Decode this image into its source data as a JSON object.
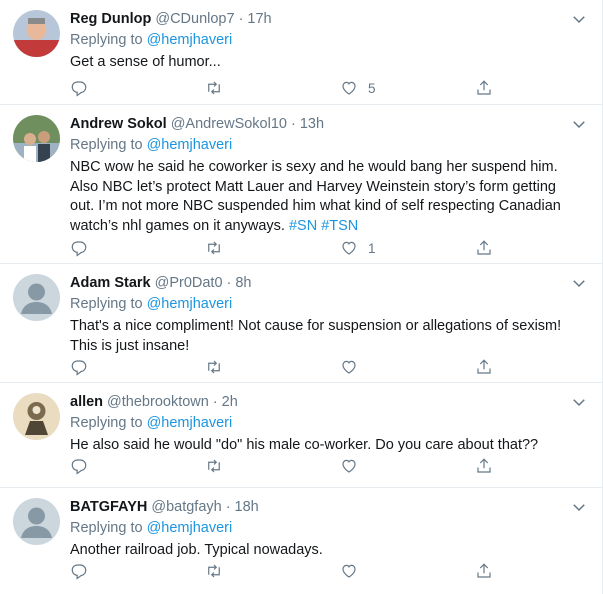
{
  "reply_prefix": "Replying to",
  "colors": {
    "link": "#1b95e0",
    "muted": "#657786",
    "text": "#14171a",
    "border": "#e6ecf0"
  },
  "icons": {
    "reply": "reply-icon",
    "retweet": "retweet-icon",
    "like": "heart-icon",
    "share": "share-icon",
    "menu": "chevron-down-icon"
  },
  "tweets": [
    {
      "name": "Reg Dunlop",
      "handle": "@CDunlop7",
      "time": "17h",
      "replying_to": "@hemjhaveri",
      "text": "Get a sense of humor...",
      "hashtags": "",
      "likes": "5"
    },
    {
      "name": "Andrew Sokol",
      "handle": "@AndrewSokol10",
      "time": "13h",
      "replying_to": "@hemjhaveri",
      "text": "NBC wow he said he coworker is sexy and he would bang her suspend him. Also NBC let’s protect Matt Lauer and Harvey Weinstein story’s form getting out. I’m not more NBC suspended him what kind of self respecting Canadian watch’s nhl games on it anyways. ",
      "hashtags": "#SN #TSN",
      "likes": "1"
    },
    {
      "name": "Adam Stark",
      "handle": "@Pr0Dat0",
      "time": "8h",
      "replying_to": "@hemjhaveri",
      "text": "That's a nice compliment! Not cause for suspension or allegations of sexism! This is just insane!",
      "hashtags": "",
      "likes": ""
    },
    {
      "name": "allen",
      "handle": "@thebrooktown",
      "time": "2h",
      "replying_to": "@hemjhaveri",
      "text": "He also said he would \"do\" his male co-worker.  Do you care about that??",
      "hashtags": "",
      "likes": ""
    },
    {
      "name": "BATGFAYH",
      "handle": "@batgfayh",
      "time": "18h",
      "replying_to": "@hemjhaveri",
      "text": "Another railroad job. Typical nowadays.",
      "hashtags": "",
      "likes": ""
    }
  ]
}
